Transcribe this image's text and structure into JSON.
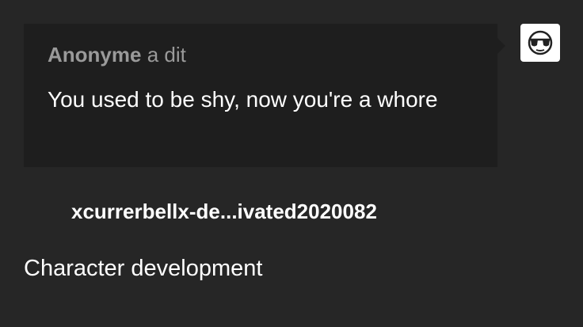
{
  "ask": {
    "asker_name": "Anonyme",
    "asker_suffix": " a dit",
    "question": "You used to be shy, now you're a whore",
    "avatar_icon": "anonymous-sunglasses-icon"
  },
  "post": {
    "reblogger": "xcurrerbellx-de...ivated2020082",
    "answer": "Character development"
  },
  "colors": {
    "background": "#262626",
    "bubble": "#1e1e1e",
    "muted_text": "#9a9a9a",
    "text": "#ffffff"
  }
}
